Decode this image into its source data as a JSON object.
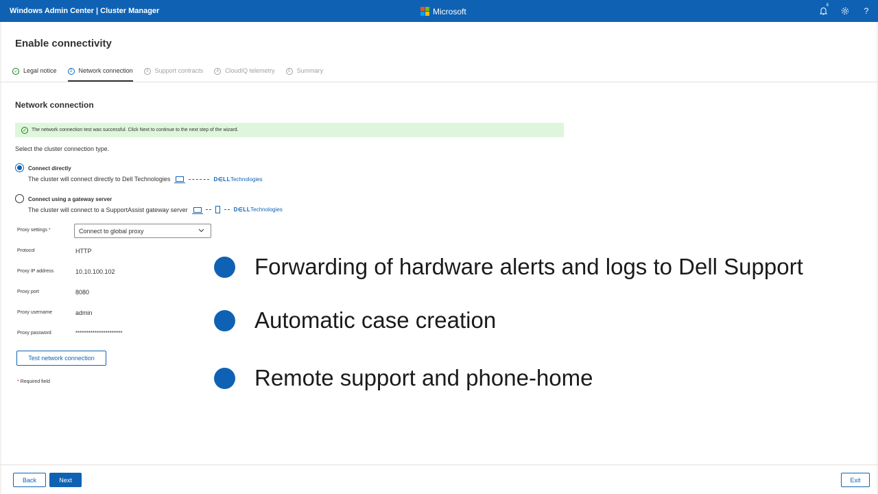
{
  "topbar": {
    "app_title": "Windows Admin Center | Cluster Manager",
    "brand_name": "Microsoft",
    "brand_colors": [
      "#f25022",
      "#7fba00",
      "#00a4ef",
      "#ffb900"
    ],
    "notification_count": "8",
    "icons": [
      "bell-icon",
      "gear-icon",
      "help-icon"
    ]
  },
  "page": {
    "title": "Enable connectivity"
  },
  "steps": [
    {
      "num": "✓",
      "label": "Legal notice",
      "state": "done"
    },
    {
      "num": "2",
      "label": "Network connection",
      "state": "active"
    },
    {
      "num": "3",
      "label": "Support contracts",
      "state": "pending"
    },
    {
      "num": "4",
      "label": "CloudIQ telemetry",
      "state": "pending"
    },
    {
      "num": "5",
      "label": "Summary",
      "state": "pending"
    }
  ],
  "section": {
    "title": "Network connection",
    "success_message": "The network connection test was successful. Click Next to continue to the next step of the wizard.",
    "select_type_label": "Select the cluster connection type."
  },
  "options": {
    "direct": {
      "label": "Connect directly",
      "description": "The cluster will connect directly to Dell Technologies",
      "selected": true
    },
    "gateway": {
      "label": "Connect using a gateway server",
      "description": "The cluster will connect to a SupportAssist gateway server",
      "selected": false
    },
    "dell_logo_bold": "D∈LL",
    "dell_logo_rest": "Technologies"
  },
  "form": {
    "proxy_settings_label": "Proxy settings",
    "required_mark": "*",
    "proxy_settings_value": "Connect to global proxy",
    "protocol_label": "Protocol",
    "protocol_value": "HTTP",
    "proxy_ip_label": "Proxy IP address",
    "proxy_ip_value": "10.10.100.102",
    "proxy_port_label": "Proxy port",
    "proxy_port_value": "8080",
    "proxy_username_label": "Proxy username",
    "proxy_username_value": "admin",
    "proxy_password_label": "Proxy password",
    "proxy_password_value": "**********************",
    "test_button": "Test network connection",
    "required_note": "Required field"
  },
  "bullets": [
    "Forwarding of hardware alerts and logs to Dell Support",
    "Automatic case creation",
    "Remote support and phone-home"
  ],
  "footer": {
    "back": "Back",
    "next": "Next",
    "exit": "Exit"
  },
  "colors": {
    "accent": "#0f62b3",
    "success_bg": "#dff6dd",
    "success": "#107c10"
  }
}
